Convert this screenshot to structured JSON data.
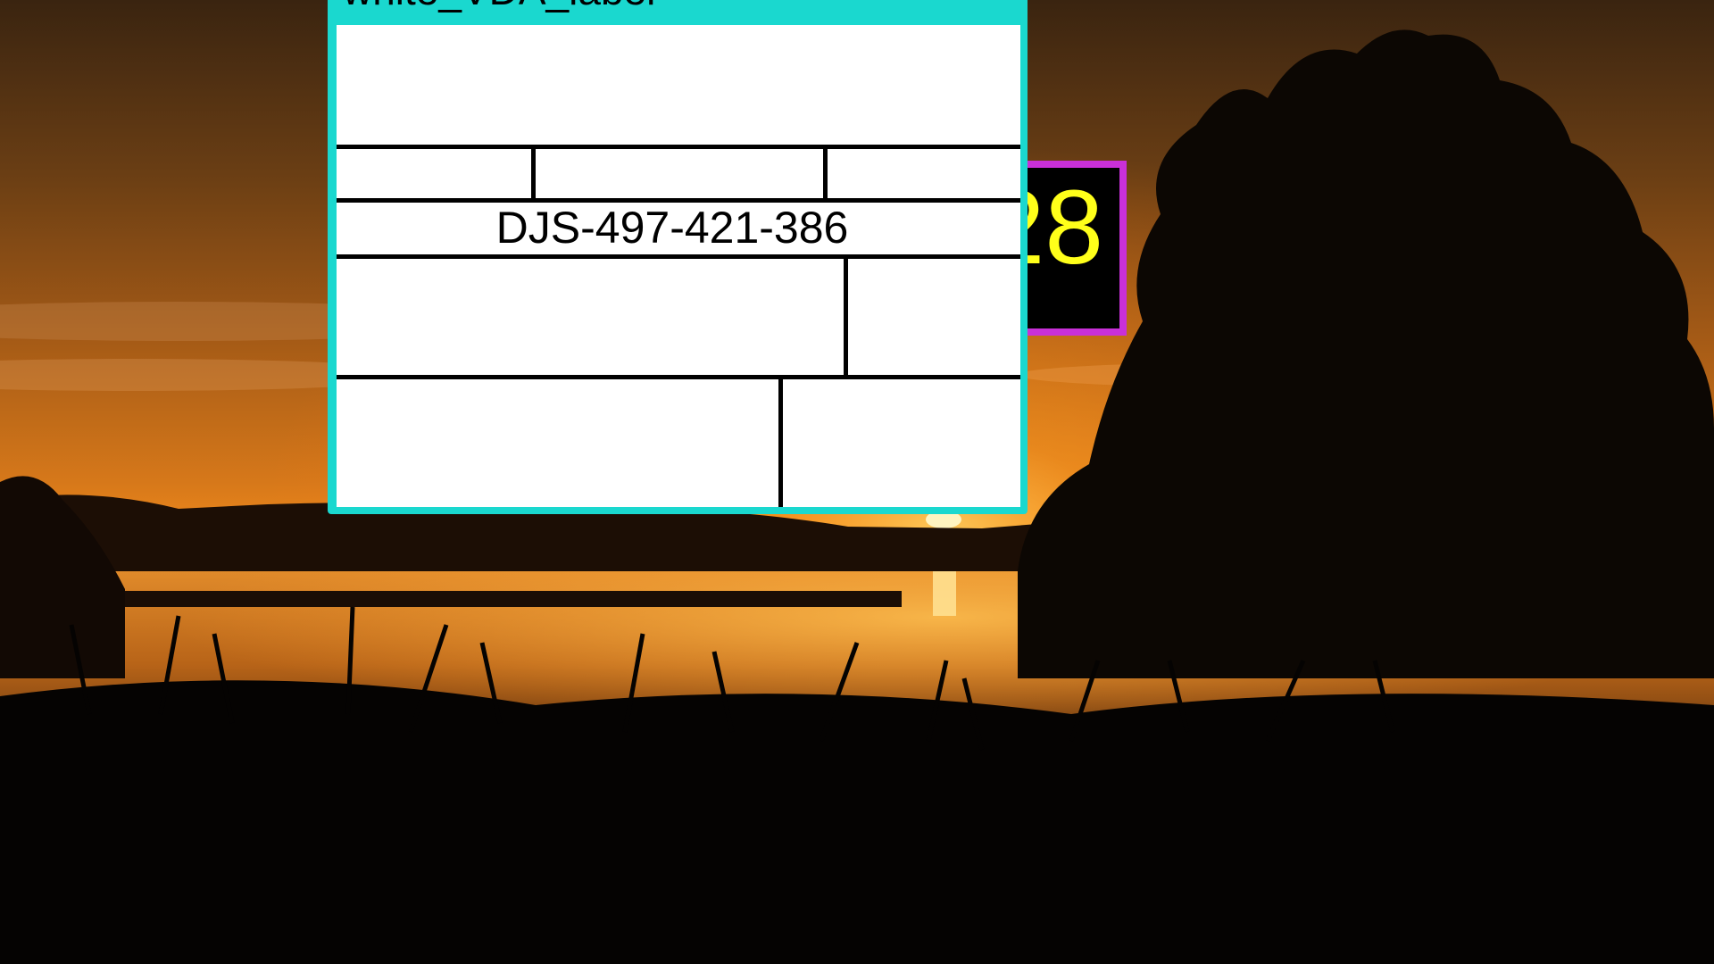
{
  "label": {
    "title": "white_VDA_label",
    "code": "DJS-497-421-386",
    "border_color": "#1ad8cf"
  },
  "badge": {
    "value": "28",
    "text_color": "#ffff1a",
    "border_color": "#c930d8"
  },
  "background": {
    "description_icon": "sunset-lake-photo"
  }
}
